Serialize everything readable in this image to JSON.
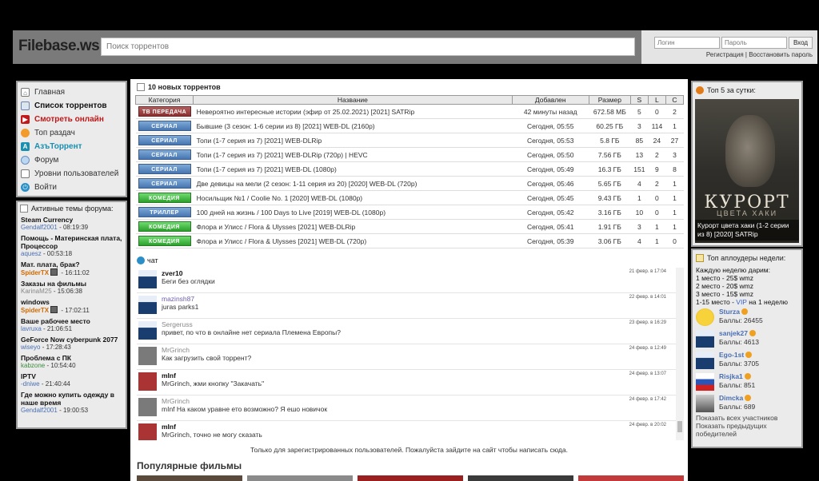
{
  "header": {
    "logo": "Filebase.ws",
    "search_placeholder": "Поиск торрентов",
    "login_placeholder": "Логин",
    "password_placeholder": "Пароль",
    "login_button": "Вход",
    "register_link": "Регистрация",
    "separator": "|",
    "restore_link": "Восстановить пароль"
  },
  "menu": [
    {
      "label": "Главная",
      "icon": "home-icon"
    },
    {
      "label": "Список торрентов",
      "icon": "list-icon"
    },
    {
      "label": "Смотреть онлайн",
      "icon": "play-icon"
    },
    {
      "label": "Топ раздач",
      "icon": "top-icon"
    },
    {
      "label": "АзъТоррент",
      "icon": "brand-icon"
    },
    {
      "label": "Форум",
      "icon": "forum-icon"
    },
    {
      "label": "Уровни пользователей",
      "icon": "levels-icon"
    },
    {
      "label": "Войти",
      "icon": "power-icon"
    }
  ],
  "forum": {
    "title": "Активные темы форума:",
    "topics": [
      {
        "title": "Steam Currency",
        "user": "Gendalf2001",
        "time": "- 08:19:39",
        "style": "blue"
      },
      {
        "title": "Помощь - Материнская плата, Процессор",
        "user": "aquesz",
        "time": "- 00:53:18",
        "style": "blue"
      },
      {
        "title": "Мат. плата, брак?",
        "user": "SpiderTX",
        "time": "- 16:11:02",
        "style": "orange"
      },
      {
        "title": "Заказы на фильмы",
        "user": "KarinaM25",
        "time": "- 15:06:38",
        "style": "gray"
      },
      {
        "title": "windows",
        "user": "SpiderTX",
        "time": "- 17:02:11",
        "style": "orange"
      },
      {
        "title": "Ваше рабочее место",
        "user": "lavruxa",
        "time": "- 21:06:51",
        "style": "blue"
      },
      {
        "title": "GeForce Now cyberpunk 2077",
        "user": "wiseyo",
        "time": "- 17:28:43",
        "style": "blue"
      },
      {
        "title": "Проблема с ПК",
        "user": "kabzone",
        "time": "- 10:54:40",
        "style": "green"
      },
      {
        "title": "IPTV",
        "user": "-dniwe",
        "time": "- 21:40:44",
        "style": "plain"
      },
      {
        "title": "Где можно купить одежду в наше время",
        "user": "Gendalf2001",
        "time": "- 19:00:53",
        "style": "blue"
      }
    ]
  },
  "torrents": {
    "title": "10 новых торрентов",
    "columns": [
      "Категория",
      "Название",
      "Добавлен",
      "Размер",
      "S",
      "L",
      "C"
    ],
    "rows": [
      {
        "cat": "ТВ ПЕРЕДАЧА",
        "cat_type": "tv",
        "name": "Невероятно интересные истории (эфир от 25.02.2021) [2021] SATRip",
        "date": "42 минуты назад",
        "size": "672.58 МБ",
        "s": "5",
        "l": "0",
        "c": "2"
      },
      {
        "cat": "СЕРИАЛ",
        "cat_type": "ser",
        "name": "Бывшие (3 сезон: 1-6 серии из 8) [2021] WEB-DL (2160p)",
        "date": "Сегодня, 05:55",
        "size": "60.25 ГБ",
        "s": "3",
        "l": "114",
        "c": "1"
      },
      {
        "cat": "СЕРИАЛ",
        "cat_type": "ser",
        "name": "Топи (1-7 серия из 7) [2021] WEB-DLRip",
        "date": "Сегодня, 05:53",
        "size": "5.8 ГБ",
        "s": "85",
        "l": "24",
        "c": "27"
      },
      {
        "cat": "СЕРИАЛ",
        "cat_type": "ser",
        "name": "Топи (1-7 серия из 7) [2021] WEB-DLRip (720p) | HEVC",
        "date": "Сегодня, 05:50",
        "size": "7.56 ГБ",
        "s": "13",
        "l": "2",
        "c": "3"
      },
      {
        "cat": "СЕРИАЛ",
        "cat_type": "ser",
        "name": "Топи (1-7 серия из 7) [2021] WEB-DL (1080p)",
        "date": "Сегодня, 05:49",
        "size": "16.3 ГБ",
        "s": "151",
        "l": "9",
        "c": "8"
      },
      {
        "cat": "СЕРИАЛ",
        "cat_type": "ser",
        "name": "Две девицы на мели (2 сезон: 1-11 серия из 20) [2020] WEB-DL (720p)",
        "date": "Сегодня, 05:46",
        "size": "5.65 ГБ",
        "s": "4",
        "l": "2",
        "c": "1"
      },
      {
        "cat": "КОМЕДИЯ",
        "cat_type": "kom",
        "name": "Носильщик №1 / Coolie No. 1 [2020] WEB-DL (1080p)",
        "date": "Сегодня, 05:45",
        "size": "9.43 ГБ",
        "s": "1",
        "l": "0",
        "c": "1"
      },
      {
        "cat": "ТРИЛЛЕР",
        "cat_type": "tri",
        "name": "100 дней на жизнь / 100 Days to Live [2019] WEB-DL (1080p)",
        "date": "Сегодня, 05:42",
        "size": "3.16 ГБ",
        "s": "10",
        "l": "0",
        "c": "1"
      },
      {
        "cat": "КОМЕДИЯ",
        "cat_type": "kom",
        "name": "Флора и Улисс / Flora & Ulysses [2021] WEB-DLRip",
        "date": "Сегодня, 05:41",
        "size": "1.91 ГБ",
        "s": "3",
        "l": "1",
        "c": "1"
      },
      {
        "cat": "КОМЕДИЯ",
        "cat_type": "kom",
        "name": "Флора и Улисс / Flora & Ulysses [2021] WEB-DL (720p)",
        "date": "Сегодня, 05:39",
        "size": "3.06 ГБ",
        "s": "4",
        "l": "1",
        "c": "0"
      }
    ]
  },
  "chat": {
    "title": "чат",
    "messages": [
      {
        "user": "zver10",
        "text": "Беги без оглядки",
        "date": "21 февр. в 17:04",
        "style": "bold",
        "avatar": "blue"
      },
      {
        "user": "mazinsh87",
        "text": "juras parks1",
        "date": "22 февр. в 14:01",
        "style": "purple",
        "avatar": "blue"
      },
      {
        "user": "Sergeruss",
        "text": "привет, по что в онлайне нет сериала Племена Европы?",
        "date": "23 февр. в 16:29",
        "style": "light",
        "avatar": "blue"
      },
      {
        "user": "MrGrinch",
        "text": "Как загрузить свой торрент?",
        "date": "24 февр. в 12:49",
        "style": "light",
        "avatar": "mr"
      },
      {
        "user": "mInf",
        "text": "MrGrinch, жми кнопку \"Закачать\"",
        "date": "24 февр. в 13:07",
        "style": "bold",
        "avatar": "robot"
      },
      {
        "user": "MrGrinch",
        "text": "mInf На каком уравне ето возможно? Я ешо новичок",
        "date": "24 февр. в 17:42",
        "style": "light",
        "avatar": "mr"
      },
      {
        "user": "mInf",
        "text": "MrGrinch, точно не могу сказать",
        "date": "24 февр. в 20:02",
        "style": "bold",
        "avatar": "robot"
      }
    ],
    "note": "Только для зарегистрированных пользователей. Пожалуйста зайдите на сайт чтобы написать сюда."
  },
  "popular": {
    "title": "Популярные фильмы"
  },
  "top5": {
    "title": "Топ 5 за сутки:",
    "poster_title": "КУРОРТ",
    "poster_subtitle": "ЦВЕТА ХАКИ",
    "caption": "Курорт цвета хаки (1-2 серии из 8) [2020] SATRip"
  },
  "uploaders": {
    "title": "Топ аплоудеры недели:",
    "intro": "Каждую неделю дарим:",
    "prize1": "1 место - 25$ wmz",
    "prize2": "2 место - 20$ wmz",
    "prize3": "3 место - 15$ wmz",
    "prize_rest_a": "1-15 место - ",
    "prize_rest_vip": "VIP",
    "prize_rest_b": " на 1 неделю",
    "users": [
      {
        "name": "Sturza",
        "points": "Баллы: 26455",
        "avatar": "smile"
      },
      {
        "name": "sanjek27",
        "points": "Баллы: 4613",
        "avatar": "blue"
      },
      {
        "name": "Ego-1st",
        "points": "Баллы: 3705",
        "avatar": "blue"
      },
      {
        "name": "Risjka1",
        "points": "Баллы: 851",
        "avatar": "flag"
      },
      {
        "name": "Dimcka",
        "points": "Баллы: 689",
        "avatar": "photo"
      }
    ],
    "show_all": "Показать всех участников",
    "show_prev": "Показать предыдущих победителей"
  }
}
